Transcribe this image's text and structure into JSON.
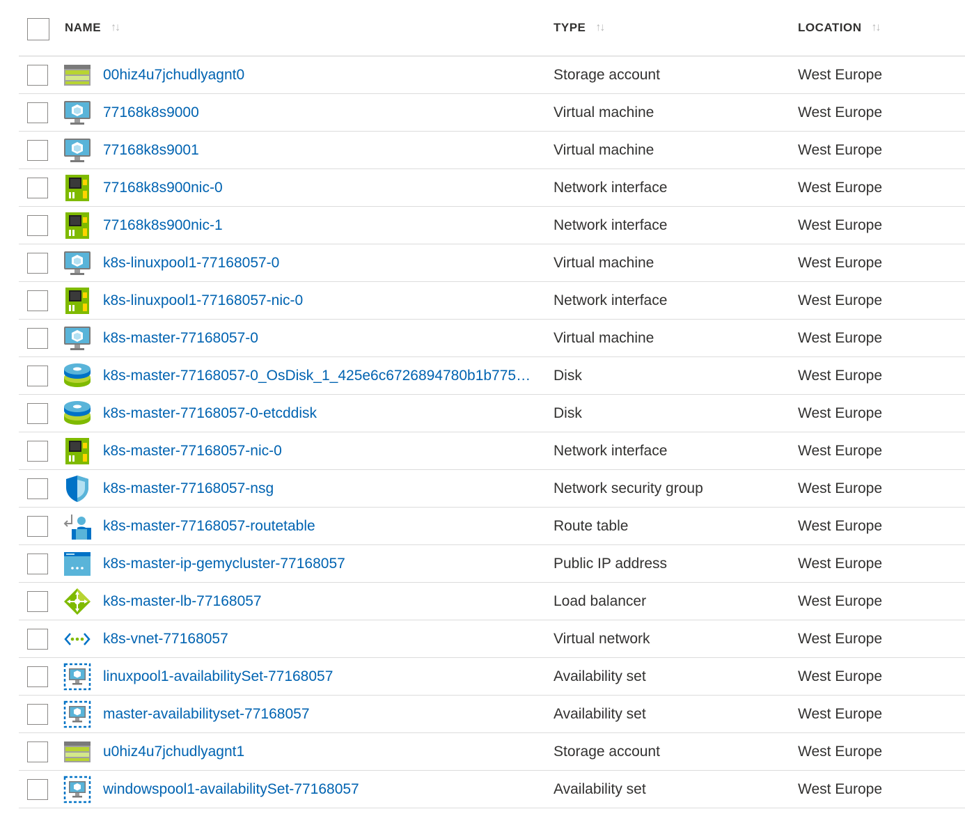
{
  "columns": {
    "name": "NAME",
    "type": "TYPE",
    "location": "LOCATION",
    "sort_icon": "↑↓"
  },
  "rows": [
    {
      "name": "00hiz4u7jchudlyagnt0",
      "type": "Storage account",
      "location": "West Europe",
      "icon": "storage-account-icon"
    },
    {
      "name": "77168k8s9000",
      "type": "Virtual machine",
      "location": "West Europe",
      "icon": "virtual-machine-icon"
    },
    {
      "name": "77168k8s9001",
      "type": "Virtual machine",
      "location": "West Europe",
      "icon": "virtual-machine-icon"
    },
    {
      "name": "77168k8s900nic-0",
      "type": "Network interface",
      "location": "West Europe",
      "icon": "network-interface-icon"
    },
    {
      "name": "77168k8s900nic-1",
      "type": "Network interface",
      "location": "West Europe",
      "icon": "network-interface-icon"
    },
    {
      "name": "k8s-linuxpool1-77168057-0",
      "type": "Virtual machine",
      "location": "West Europe",
      "icon": "virtual-machine-icon"
    },
    {
      "name": "k8s-linuxpool1-77168057-nic-0",
      "type": "Network interface",
      "location": "West Europe",
      "icon": "network-interface-icon"
    },
    {
      "name": "k8s-master-77168057-0",
      "type": "Virtual machine",
      "location": "West Europe",
      "icon": "virtual-machine-icon"
    },
    {
      "name": "k8s-master-77168057-0_OsDisk_1_425e6c6726894780b1b775c⋯",
      "type": "Disk",
      "location": "West Europe",
      "icon": "disk-icon"
    },
    {
      "name": "k8s-master-77168057-0-etcddisk",
      "type": "Disk",
      "location": "West Europe",
      "icon": "disk-icon"
    },
    {
      "name": "k8s-master-77168057-nic-0",
      "type": "Network interface",
      "location": "West Europe",
      "icon": "network-interface-icon"
    },
    {
      "name": "k8s-master-77168057-nsg",
      "type": "Network security group",
      "location": "West Europe",
      "icon": "shield-icon"
    },
    {
      "name": "k8s-master-77168057-routetable",
      "type": "Route table",
      "location": "West Europe",
      "icon": "route-table-icon"
    },
    {
      "name": "k8s-master-ip-gemycluster-77168057",
      "type": "Public IP address",
      "location": "West Europe",
      "icon": "public-ip-icon"
    },
    {
      "name": "k8s-master-lb-77168057",
      "type": "Load balancer",
      "location": "West Europe",
      "icon": "load-balancer-icon"
    },
    {
      "name": "k8s-vnet-77168057",
      "type": "Virtual network",
      "location": "West Europe",
      "icon": "virtual-network-icon"
    },
    {
      "name": "linuxpool1-availabilitySet-77168057",
      "type": "Availability set",
      "location": "West Europe",
      "icon": "availability-set-icon"
    },
    {
      "name": "master-availabilityset-77168057",
      "type": "Availability set",
      "location": "West Europe",
      "icon": "availability-set-icon"
    },
    {
      "name": "u0hiz4u7jchudlyagnt1",
      "type": "Storage account",
      "location": "West Europe",
      "icon": "storage-account-icon"
    },
    {
      "name": "windowspool1-availabilitySet-77168057",
      "type": "Availability set",
      "location": "West Europe",
      "icon": "availability-set-icon"
    }
  ]
}
